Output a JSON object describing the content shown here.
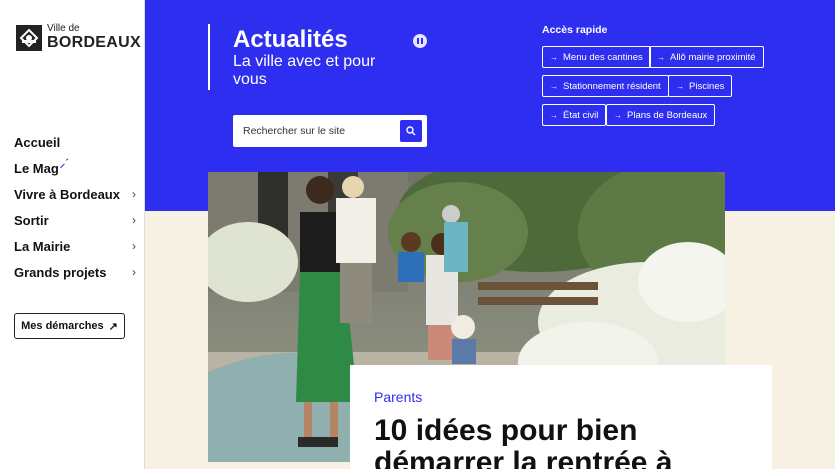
{
  "logo": {
    "small": "Ville de",
    "big": "BORDEAUX"
  },
  "nav": {
    "items": [
      {
        "label": "Accueil",
        "has_chevron": false
      },
      {
        "label": "Le Mag",
        "has_chevron": false
      },
      {
        "label": "Vivre à Bordeaux",
        "has_chevron": true
      },
      {
        "label": "Sortir",
        "has_chevron": true
      },
      {
        "label": "La Mairie",
        "has_chevron": true
      },
      {
        "label": "Grands projets",
        "has_chevron": true
      }
    ],
    "demarches_label": "Mes démarches"
  },
  "header": {
    "title": "Actualités",
    "subtitle": "La ville avec et pour vous",
    "search_placeholder": "Rechercher sur le site"
  },
  "quick_access": {
    "title": "Accès rapide",
    "links": [
      "Menu des cantines",
      "Allô mairie proximité",
      "Stationnement résident",
      "Piscines",
      "État civil",
      "Plans de Bordeaux"
    ]
  },
  "featured": {
    "category": "Parents",
    "title": "10 idées pour bien démarrer la rentrée à"
  },
  "colors": {
    "accent": "#2e2ef0",
    "cream": "#f7f1e4"
  }
}
